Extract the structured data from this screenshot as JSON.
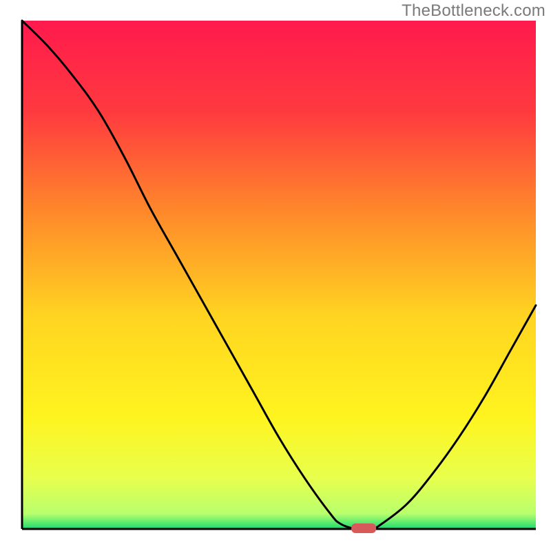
{
  "watermark": "TheBottleneck.com",
  "chart_data": {
    "type": "line",
    "title": "",
    "xlabel": "",
    "ylabel": "",
    "xlim": [
      0,
      100
    ],
    "ylim": [
      0,
      100
    ],
    "x": [
      0,
      5,
      10,
      15,
      20,
      25,
      30,
      35,
      40,
      45,
      50,
      55,
      60,
      62,
      65,
      68,
      70,
      75,
      80,
      85,
      90,
      95,
      100
    ],
    "values": [
      100,
      95,
      89,
      82,
      73,
      63,
      54,
      45,
      36,
      27,
      18,
      10,
      3,
      1,
      0,
      0,
      1,
      5,
      11,
      18,
      26,
      35,
      44
    ],
    "marker": {
      "x": 66.5,
      "y": 0
    },
    "background_gradient": {
      "stops": [
        {
          "offset": 0.0,
          "color": "#ff1a4d"
        },
        {
          "offset": 0.18,
          "color": "#ff3a3f"
        },
        {
          "offset": 0.38,
          "color": "#ff8a2a"
        },
        {
          "offset": 0.58,
          "color": "#ffd421"
        },
        {
          "offset": 0.78,
          "color": "#fff41f"
        },
        {
          "offset": 0.9,
          "color": "#e8ff4d"
        },
        {
          "offset": 0.97,
          "color": "#b8ff6d"
        },
        {
          "offset": 1.0,
          "color": "#1adc70"
        }
      ]
    },
    "grid": false,
    "legend": false
  }
}
